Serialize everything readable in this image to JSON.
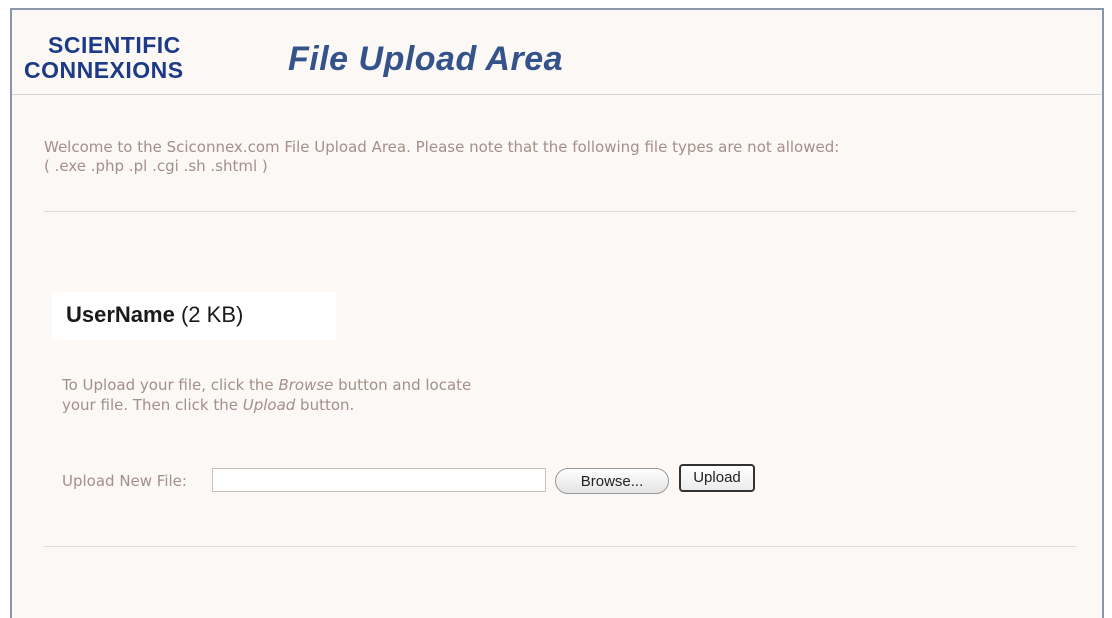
{
  "header": {
    "logo_line1": "SCIENTIFIC",
    "logo_line2": "CONNEXIONS",
    "title": "File Upload Area"
  },
  "welcome": {
    "line1": "Welcome to the Sciconnex.com File Upload Area. Please note that the following file types are not allowed:",
    "line2": "( .exe  .php  .pl  .cgi  .sh  .shtml )"
  },
  "user": {
    "name": "UserName",
    "size": "(2 KB)"
  },
  "instructions": {
    "part1": "To Upload your file, click the ",
    "browse_word": "Browse",
    "part2": " button and locate",
    "part3": "your file. Then click the ",
    "upload_word": "Upload",
    "part4": " button."
  },
  "form": {
    "label": "Upload New File:",
    "file_value": "",
    "browse_label": "Browse...",
    "upload_label": "Upload"
  },
  "colors": {
    "logo": "#1d3a86",
    "title": "#34538a",
    "body_text": "#a39088",
    "background": "#fbf8f6"
  }
}
